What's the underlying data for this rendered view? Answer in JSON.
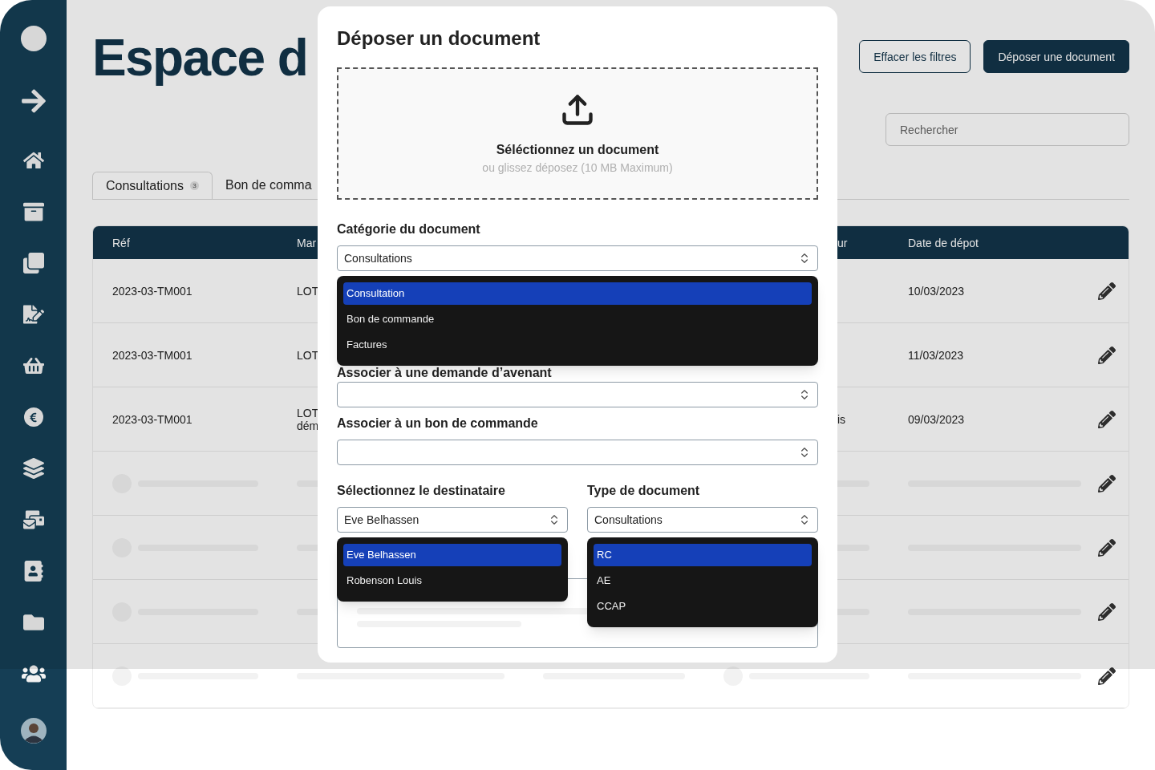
{
  "page": {
    "title": "Espace d",
    "buttons": [
      {
        "kind": "outline",
        "label": "Effacer les filtres"
      },
      {
        "kind": "primary",
        "label": "Déposer une document"
      }
    ],
    "search": {
      "placeholder": "Rechercher"
    }
  },
  "tabs": [
    {
      "label": "Consultations",
      "count": "3",
      "selected": true
    },
    {
      "label": "Bon de comma",
      "selected": false
    }
  ],
  "table": {
    "columns": [
      "Réf",
      "Mar",
      "ur",
      "Date de dépot"
    ],
    "rows": [
      {
        "kind": "data",
        "ref": "2023-03-TM001",
        "column_2": [
          "LOT"
        ],
        "date": "10/03/2023"
      },
      {
        "kind": "data",
        "ref": "2023-03-TM001",
        "column_2": [
          "LOT"
        ],
        "date": "11/03/2023"
      },
      {
        "kind": "data",
        "ref": "2023-03-TM001",
        "column_2": [
          "LOT",
          "dém"
        ],
        "column_3": "is",
        "date": "09/03/2023"
      },
      {
        "kind": "skeleton"
      },
      {
        "kind": "skeleton"
      },
      {
        "kind": "skeleton"
      },
      {
        "kind": "skeleton"
      }
    ]
  },
  "modal": {
    "title": "Déposer un document",
    "dropzone": {
      "title": "Séléctionnez un document",
      "hint": "ou glissez déposez (10 MB Maximum)"
    },
    "category": {
      "label": "Catégorie du document",
      "value": "Consultations",
      "expanded": true,
      "options": [
        {
          "label": "Consultation",
          "selected": true
        },
        {
          "label": "Bon de commande",
          "selected": false
        },
        {
          "label": "Factures",
          "selected": false
        }
      ]
    },
    "amendment": {
      "label": "Associer à une demande d’avenant"
    },
    "purchase_order": {
      "label": "Associer à un bon de commande"
    },
    "recipient": {
      "label": "Sélectionnez le destinataire",
      "value": "Eve Belhassen",
      "expanded": true,
      "options": [
        {
          "label": "Eve Belhassen",
          "selected": true
        },
        {
          "label": "Robenson Louis",
          "selected": false
        }
      ]
    },
    "document_type": {
      "label": "Type de document",
      "value": "Consultations",
      "expanded": true,
      "options": [
        {
          "label": "RC",
          "selected": true
        },
        {
          "label": "AE",
          "selected": false
        },
        {
          "label": "CCAP",
          "selected": false
        }
      ]
    }
  }
}
